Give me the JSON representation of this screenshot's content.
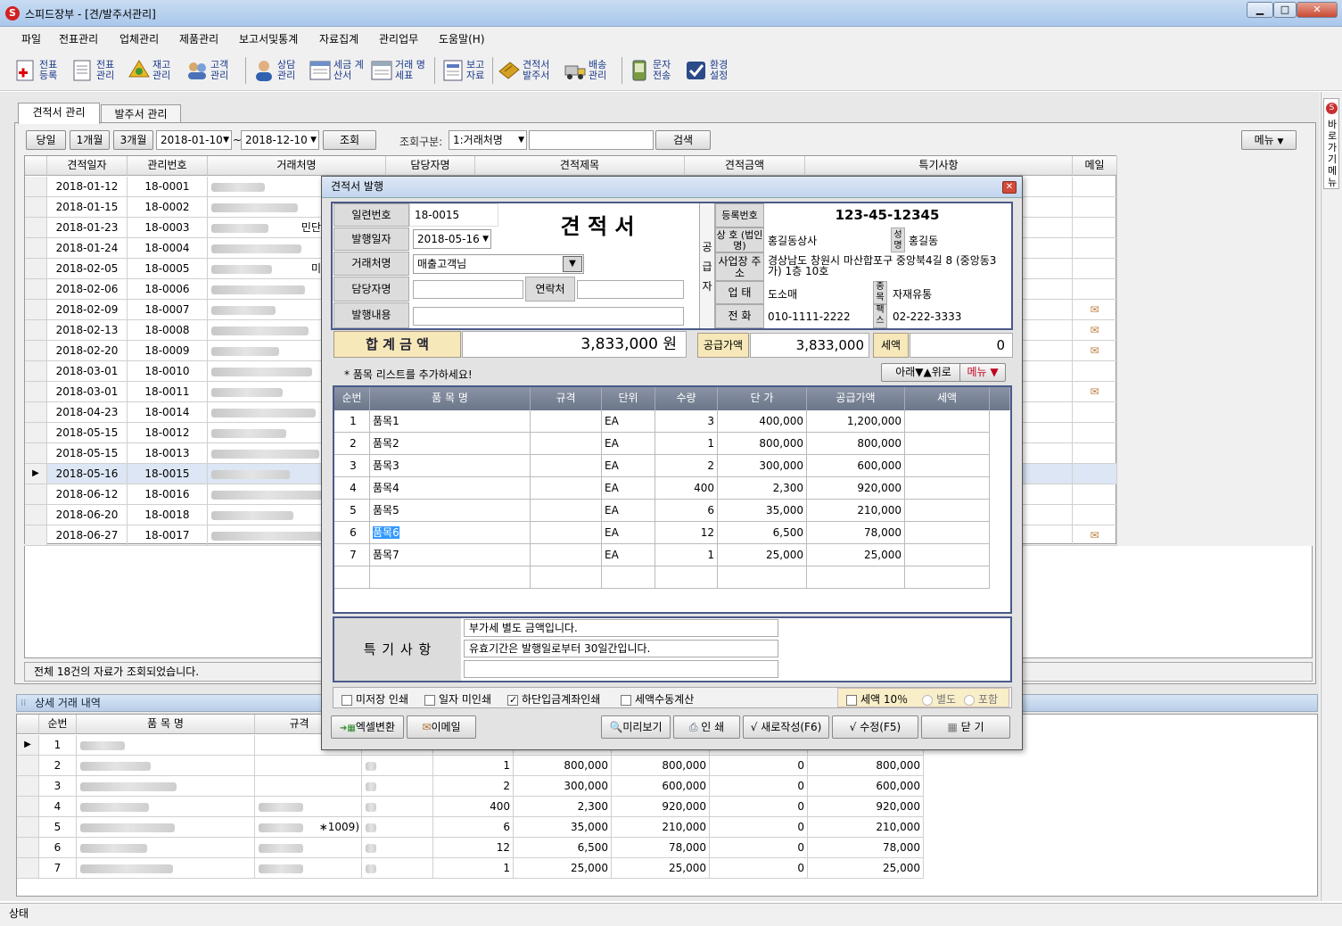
{
  "window": {
    "title": "스피드장부 - [견/발주서관리]"
  },
  "menu": [
    "파일",
    "전표관리",
    "업체관리",
    "제품관리",
    "보고서및통계",
    "자료집계",
    "관리업무",
    "도움말(H)"
  ],
  "toolbar": [
    {
      "label": "전표 등록",
      "icon": "document-add-icon"
    },
    {
      "label": "전표 관리",
      "icon": "document-list-icon"
    },
    {
      "label": "재고 관리",
      "icon": "inventory-icon"
    },
    {
      "label": "고객 관리",
      "icon": "customers-icon"
    },
    {
      "label": "상담 관리",
      "icon": "consult-icon"
    },
    {
      "label": "세금 계산서",
      "icon": "tax-invoice-icon"
    },
    {
      "label": "거래 명세표",
      "icon": "statement-icon"
    },
    {
      "label": "보고 자료",
      "icon": "report-icon"
    },
    {
      "label": "견적서 발주서",
      "icon": "estimate-icon"
    },
    {
      "label": "배송 관리",
      "icon": "delivery-icon"
    },
    {
      "label": "문자 전송",
      "icon": "sms-icon"
    },
    {
      "label": "환경 설정",
      "icon": "settings-check-icon"
    }
  ],
  "quickbar": {
    "label": "바로가기 메뉴"
  },
  "tabs": [
    {
      "label": "견적서 관리"
    },
    {
      "label": "발주서 관리"
    }
  ],
  "filter": {
    "today": "당일",
    "one_month": "1개월",
    "three_months": "3개월",
    "date_from": "2018-01-10",
    "date_to": "2018-12-10",
    "date_sep": "~",
    "search_btn": "조회",
    "category_label": "조회구분:",
    "category_value": "1:거래처명",
    "search_input": "",
    "find_btn": "검색",
    "menu_btn": "메뉴"
  },
  "list": {
    "columns": [
      "견적일자",
      "관리번호",
      "거래처명",
      "담당자명",
      "견적제목",
      "견적금액",
      "특기사항",
      "메일"
    ],
    "rows": [
      {
        "date": "2018-01-12",
        "no": "18-0001",
        "mail": false
      },
      {
        "date": "2018-01-15",
        "no": "18-0002",
        "mail": false
      },
      {
        "date": "2018-01-23",
        "no": "18-0003",
        "mail": false,
        "suffix": "민단"
      },
      {
        "date": "2018-01-24",
        "no": "18-0004",
        "mail": false
      },
      {
        "date": "2018-02-05",
        "no": "18-0005",
        "mail": false,
        "suffix": "미"
      },
      {
        "date": "2018-02-06",
        "no": "18-0006",
        "mail": false
      },
      {
        "date": "2018-02-09",
        "no": "18-0007",
        "mail": true
      },
      {
        "date": "2018-02-13",
        "no": "18-0008",
        "mail": true
      },
      {
        "date": "2018-02-20",
        "no": "18-0009",
        "mail": true
      },
      {
        "date": "2018-03-01",
        "no": "18-0010",
        "mail": false
      },
      {
        "date": "2018-03-01",
        "no": "18-0011",
        "mail": true
      },
      {
        "date": "2018-04-23",
        "no": "18-0014",
        "mail": false
      },
      {
        "date": "2018-05-15",
        "no": "18-0012",
        "mail": false
      },
      {
        "date": "2018-05-15",
        "no": "18-0013",
        "mail": false
      },
      {
        "date": "2018-05-16",
        "no": "18-0015",
        "mail": false,
        "selected": true
      },
      {
        "date": "2018-06-12",
        "no": "18-0016",
        "mail": false
      },
      {
        "date": "2018-06-20",
        "no": "18-0018",
        "mail": false
      },
      {
        "date": "2018-06-27",
        "no": "18-0017",
        "mail": true
      }
    ],
    "status": "전체 18건의 자료가 조회되었습니다."
  },
  "detail": {
    "title": "상세 거래 내역",
    "columns": [
      "순번",
      "품 목 명",
      "규격"
    ],
    "rows": [
      {
        "seq": "1",
        "qty": "",
        "price": "",
        "supply": "",
        "tax": "",
        "total": ""
      },
      {
        "seq": "2",
        "qty": "1",
        "price": "800,000",
        "supply": "800,000",
        "tax": "0",
        "total": "800,000"
      },
      {
        "seq": "3",
        "qty": "2",
        "price": "300,000",
        "supply": "600,000",
        "tax": "0",
        "total": "600,000"
      },
      {
        "seq": "4",
        "qty": "400",
        "price": "2,300",
        "supply": "920,000",
        "tax": "0",
        "total": "920,000"
      },
      {
        "seq": "5",
        "qty": "6",
        "price": "35,000",
        "supply": "210,000",
        "tax": "0",
        "total": "210,000",
        "spec": "∗1009)"
      },
      {
        "seq": "6",
        "qty": "12",
        "price": "6,500",
        "supply": "78,000",
        "tax": "0",
        "total": "78,000"
      },
      {
        "seq": "7",
        "qty": "1",
        "price": "25,000",
        "supply": "25,000",
        "tax": "0",
        "total": "25,000"
      }
    ]
  },
  "status_bar": "상태",
  "dialog": {
    "title": "견적서 발행",
    "doc_title": "견 적 서",
    "serial_label": "일련번호",
    "serial": "18-0015",
    "issue_label": "발행일자",
    "issue_date": "2018-05-16",
    "client_label": "거래처명",
    "client": "매출고객님",
    "manager_label": "담당자명",
    "manager": "",
    "contact_label": "연락처",
    "contact": "",
    "content_label": "발행내용",
    "content": "",
    "supplier_label": "공 급 자",
    "reg_label": "등록번호",
    "reg_no": "123-45-12345",
    "company_label": "상 호 (법인명)",
    "company": "홍길동상사",
    "ceo_label": "성명",
    "ceo": "홍길동",
    "addr_label": "사업장 주 소",
    "addr": "경상남도 창원시 마산합포구 중앙북4길 8 (중앙동3가) 1층 10호",
    "biz_label": "업 태",
    "biz": "도소매",
    "item_label": "종목",
    "item": "자재유통",
    "tel_label": "전 화",
    "tel": "010-1111-2222",
    "fax_label": "팩스",
    "fax": "02-222-3333",
    "total_label": "합 계 금 액",
    "total": "3,833,000 원",
    "supply_label": "공급가액",
    "supply": "3,833,000",
    "tax_label": "세액",
    "tax": "0",
    "items_hint": "* 품목 리스트를 추가하세요!",
    "down_btn": "아래▼",
    "up_btn": "▲위로",
    "menu_btn": "메뉴 ▼",
    "item_columns": [
      "순번",
      "품 목 명",
      "규격",
      "단위",
      "수량",
      "단 가",
      "공급가액",
      "세액"
    ],
    "items": [
      {
        "seq": "1",
        "name": "품목1",
        "spec": "",
        "unit": "EA",
        "qty": "3",
        "price": "400,000",
        "amount": "1,200,000",
        "tax": ""
      },
      {
        "seq": "2",
        "name": "품목2",
        "spec": "",
        "unit": "EA",
        "qty": "1",
        "price": "800,000",
        "amount": "800,000",
        "tax": ""
      },
      {
        "seq": "3",
        "name": "품목3",
        "spec": "",
        "unit": "EA",
        "qty": "2",
        "price": "300,000",
        "amount": "600,000",
        "tax": ""
      },
      {
        "seq": "4",
        "name": "품목4",
        "spec": "",
        "unit": "EA",
        "qty": "400",
        "price": "2,300",
        "amount": "920,000",
        "tax": ""
      },
      {
        "seq": "5",
        "name": "품목5",
        "spec": "",
        "unit": "EA",
        "qty": "6",
        "price": "35,000",
        "amount": "210,000",
        "tax": ""
      },
      {
        "seq": "6",
        "name": "품목6",
        "spec": "",
        "unit": "EA",
        "qty": "12",
        "price": "6,500",
        "amount": "78,000",
        "tax": ""
      },
      {
        "seq": "7",
        "name": "품목7",
        "spec": "",
        "unit": "EA",
        "qty": "1",
        "price": "25,000",
        "amount": "25,000",
        "tax": ""
      }
    ],
    "remarks_label": "특 기 사 항",
    "remarks": [
      "부가세 별도 금액입니다.",
      "유효기간은 발행일로부터 30일간입니다.",
      ""
    ],
    "opt_no_stamp": "미저장 인쇄",
    "opt_no_date": "일자 미인쇄",
    "opt_bank": "하단입금계좌인쇄",
    "opt_manual_tax": "세액수동계산",
    "opt_tax10": "세액 10％",
    "opt_separate": "별도",
    "opt_include": "포함",
    "btn_excel": "엑셀변환",
    "btn_email": "이메일",
    "btn_preview": "미리보기",
    "btn_print": "인 쇄",
    "btn_new": "√ 새로작성(F6)",
    "btn_edit": "√  수정(F5)",
    "btn_close": "닫 기"
  }
}
